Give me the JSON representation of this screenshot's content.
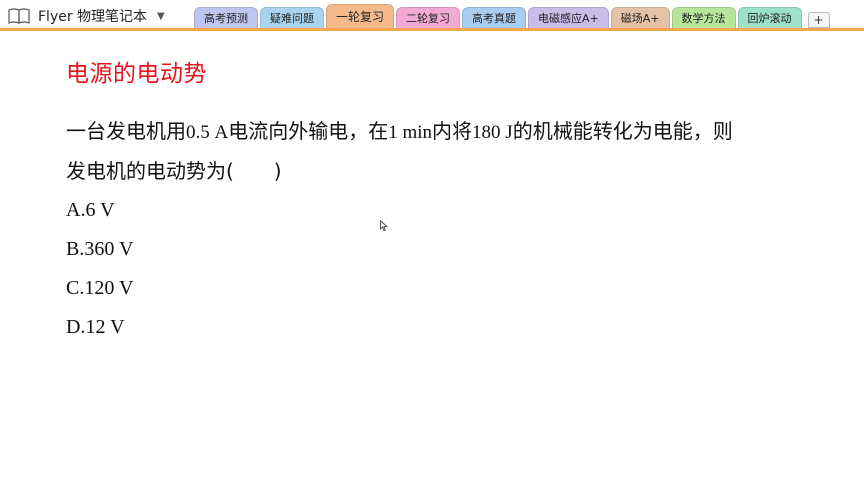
{
  "app": {
    "title": "Flyer 物理笔记本",
    "menu_icon": "chevron-down-icon",
    "notebook_icon": "notebook-icon"
  },
  "tabs": [
    {
      "label": "高考预测",
      "color": "#bcc6ee",
      "active": false
    },
    {
      "label": "疑难问题",
      "color": "#a9d3ee",
      "active": false
    },
    {
      "label": "一轮复习",
      "color": "#f6b98a",
      "active": true
    },
    {
      "label": "二轮复习",
      "color": "#f3a9d6",
      "active": false
    },
    {
      "label": "高考真题",
      "color": "#a8cdf0",
      "active": false
    },
    {
      "label": "电磁感应A+",
      "color": "#c9bde9",
      "active": false
    },
    {
      "label": "磁场A+",
      "color": "#e3c2a8",
      "active": false
    },
    {
      "label": "数学方法",
      "color": "#b6e59c",
      "active": false
    },
    {
      "label": "回炉滚动",
      "color": "#9fe0c8",
      "active": false
    }
  ],
  "add_tab_label": "+",
  "page": {
    "heading": "电源的电动势",
    "question_line1_a": "一台发电机用",
    "question_line1_b": "0.5 A",
    "question_line1_c": "电流向外输电，在",
    "question_line1_d": "1 min",
    "question_line1_e": "内将",
    "question_line1_f": "180 J",
    "question_line1_g": "的机械能转化为电能，则",
    "question_line2": "发电机的电动势为(　　)",
    "options": [
      "A.6 V",
      "B.360 V",
      "C.120 V",
      "D.12 V"
    ]
  },
  "colors": {
    "accent_line": "#f5a64a",
    "heading": "#e8141b"
  }
}
